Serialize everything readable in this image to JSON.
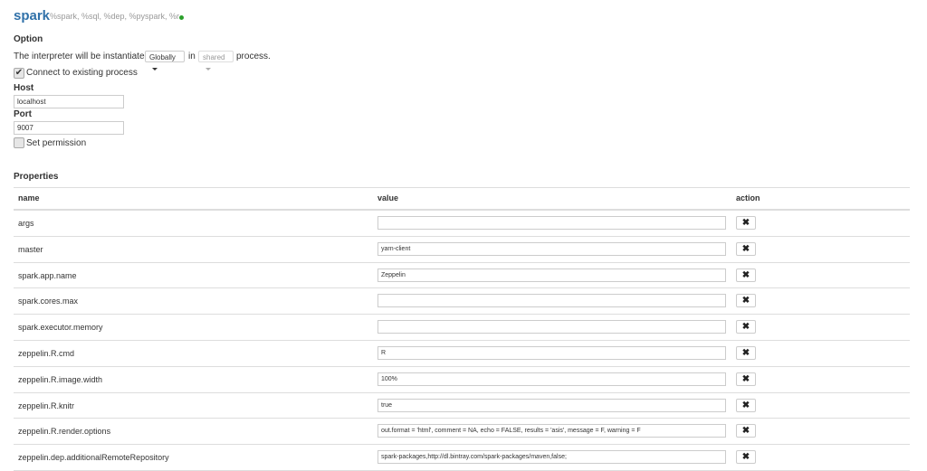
{
  "interpreter": {
    "name": "spark",
    "bindings": "%spark, %sql, %dep, %pyspark, %r",
    "status_color": "#2ca02c"
  },
  "option": {
    "heading": "Option",
    "instantiation_prefix": "The interpreter will be instantiated",
    "scope_value": "Globally",
    "in_word": "in",
    "process_value": "shared",
    "process_suffix": "process.",
    "connect_existing": {
      "label": "Connect to existing process",
      "checked": true,
      "mark": "✔"
    },
    "host": {
      "label": "Host",
      "value": "localhost"
    },
    "port": {
      "label": "Port",
      "value": "9007"
    },
    "set_permission": {
      "label": "Set permission",
      "checked": false
    }
  },
  "properties": {
    "heading": "Properties",
    "columns": {
      "name": "name",
      "value": "value",
      "action": "action"
    },
    "delete_glyph": "✖",
    "rows": [
      {
        "name": "args",
        "value": ""
      },
      {
        "name": "master",
        "value": "yarn-client"
      },
      {
        "name": "spark.app.name",
        "value": "Zeppelin"
      },
      {
        "name": "spark.cores.max",
        "value": ""
      },
      {
        "name": "spark.executor.memory",
        "value": ""
      },
      {
        "name": "zeppelin.R.cmd",
        "value": "R"
      },
      {
        "name": "zeppelin.R.image.width",
        "value": "100%"
      },
      {
        "name": "zeppelin.R.knitr",
        "value": "true"
      },
      {
        "name": "zeppelin.R.render.options",
        "value": "out.format = 'html', comment = NA, echo = FALSE, results = 'asis', message = F, warning = F"
      },
      {
        "name": "zeppelin.dep.additionalRemoteRepository",
        "value": "spark-packages,http://dl.bintray.com/spark-packages/maven,false;"
      }
    ]
  }
}
